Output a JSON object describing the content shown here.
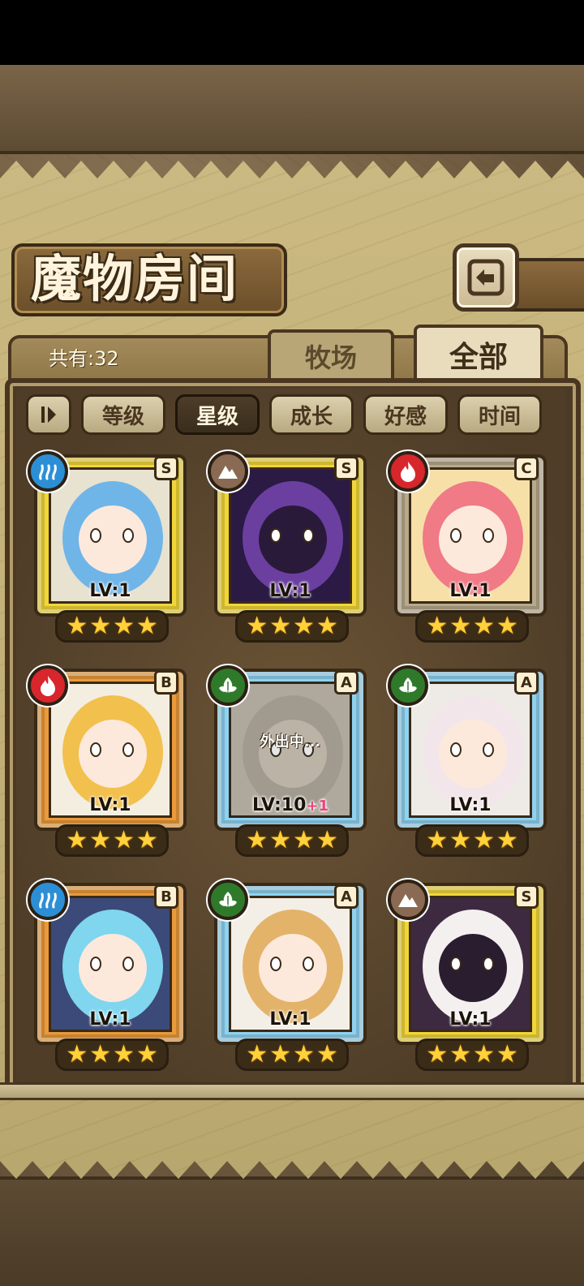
{
  "header": {
    "title": "魔物房间",
    "count_label": "共有:32"
  },
  "tabs": [
    {
      "label": "牧场",
      "active": false
    },
    {
      "label": "全部",
      "active": true
    }
  ],
  "filters": [
    {
      "label": "等级",
      "active": false
    },
    {
      "label": "星级",
      "active": true
    },
    {
      "label": "成长",
      "active": false
    },
    {
      "label": "好感",
      "active": false
    },
    {
      "label": "时间",
      "active": false
    }
  ],
  "icons": {
    "back": "back-arrow-icon",
    "sort": "sort-toggle-icon"
  },
  "element_colors": {
    "water": "#2c8fd6",
    "earth": "#8a6a52",
    "fire": "#d7262c",
    "wood": "#2f7a2a"
  },
  "rank_colors": {
    "S": "#f1d63a",
    "C": "#b7a98c",
    "B": "#ea9a3a",
    "A": "#8fd2f0"
  },
  "monsters": [
    {
      "element": "water",
      "rank": "S",
      "level": "LV:1",
      "plus": "",
      "stars": 4,
      "status": "",
      "hair": "#6fb5e8",
      "skin": "#fde9dc",
      "bg": "#e8e2d0"
    },
    {
      "element": "earth",
      "rank": "S",
      "level": "LV:1",
      "plus": "",
      "stars": 4,
      "status": "",
      "hair": "#6b3fa0",
      "skin": "#2a1a3a",
      "bg": "#2b1a44"
    },
    {
      "element": "fire",
      "rank": "C",
      "level": "LV:1",
      "plus": "",
      "stars": 4,
      "status": "",
      "hair": "#f07a86",
      "skin": "#fde9dc",
      "bg": "#f7e0a8"
    },
    {
      "element": "fire",
      "rank": "B",
      "level": "LV:1",
      "plus": "",
      "stars": 4,
      "status": "",
      "hair": "#f2c04c",
      "skin": "#fde9dc",
      "bg": "#f3eee0"
    },
    {
      "element": "wood",
      "rank": "A",
      "level": "LV:10",
      "plus": "+1",
      "stars": 4,
      "status": "外出中...",
      "hair": "#b9ab90",
      "skin": "#d8c6a8",
      "bg": "#c9bba0"
    },
    {
      "element": "wood",
      "rank": "A",
      "level": "LV:1",
      "plus": "",
      "stars": 4,
      "status": "",
      "hair": "#f3e6ea",
      "skin": "#fde9dc",
      "bg": "#eeeae6"
    },
    {
      "element": "water",
      "rank": "B",
      "level": "LV:1",
      "plus": "",
      "stars": 4,
      "status": "",
      "hair": "#7fd6ee",
      "skin": "#fde9dc",
      "bg": "#3b4a78"
    },
    {
      "element": "wood",
      "rank": "A",
      "level": "LV:1",
      "plus": "",
      "stars": 4,
      "status": "",
      "hair": "#e3b36a",
      "skin": "#fde9dc",
      "bg": "#f4efe6"
    },
    {
      "element": "earth",
      "rank": "S",
      "level": "LV:1",
      "plus": "",
      "stars": 4,
      "status": "",
      "hair": "#f5f0f0",
      "skin": "#2a1d30",
      "bg": "#3d2a40"
    }
  ]
}
